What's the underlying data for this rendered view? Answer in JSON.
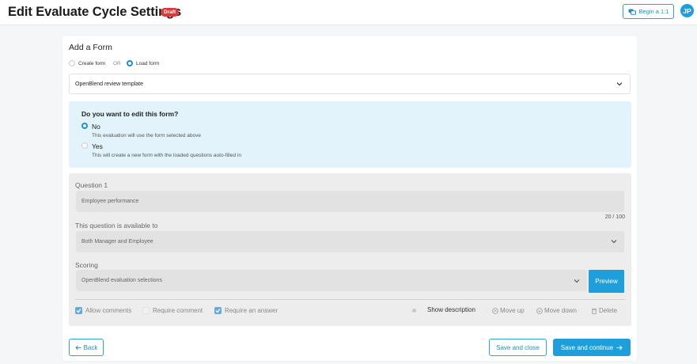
{
  "header": {
    "title": "Edit Evaluate Cycle Settings",
    "badge": "Draft",
    "begin_button": "Begin a 1:1",
    "avatar_initials": "JP"
  },
  "form": {
    "title": "Add a Form",
    "mode_options": {
      "create": "Create form",
      "or": "OR",
      "load": "Load form",
      "selected": "load"
    },
    "template_select": "OpenBlend review template"
  },
  "edit_prompt": {
    "question": "Do you want to edit this form?",
    "no_label": "No",
    "no_desc": "This evaluation will use the form selected above",
    "yes_label": "Yes",
    "yes_desc": "This will create a new form with the loaded questions auto-filled in",
    "selected": "no"
  },
  "question": {
    "label": "Question 1",
    "value": "Employee performance",
    "counter": "20 / 100",
    "availability_label": "This question is available to",
    "availability_value": "Both Manager and Employee",
    "scoring_label": "Scoring",
    "scoring_value": "OpenBlend evaluation selections",
    "preview_button": "Preview",
    "options": {
      "allow_comments": "Allow comments",
      "require_comment": "Require comment",
      "require_answer": "Require an answer",
      "show_description": "Show description",
      "move_up": "Move up",
      "move_down": "Move down",
      "delete": "Delete"
    },
    "checked": {
      "allow_comments": true,
      "require_comment": false,
      "require_answer": true
    }
  },
  "footer": {
    "back": "Back",
    "save_close": "Save and close",
    "save_continue": "Save and continue"
  },
  "colors": {
    "accent": "#1e9fdc",
    "draft": "#d93a3a",
    "info_bg": "#e2f3fb"
  }
}
